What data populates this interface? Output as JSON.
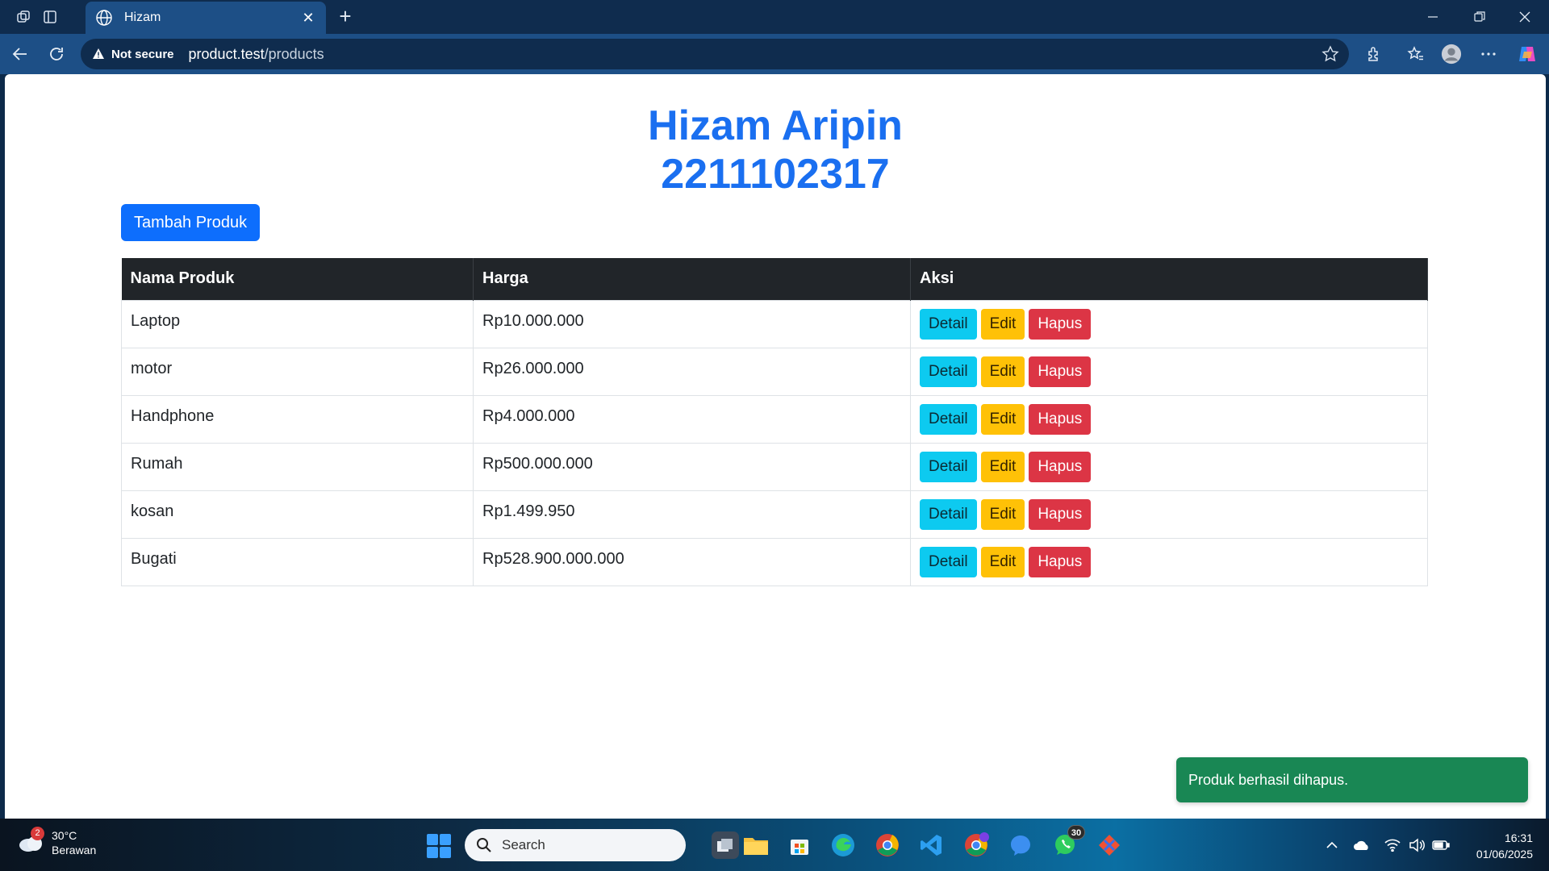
{
  "browser": {
    "tab_title": "Hizam",
    "security_label": "Not secure",
    "url_host": "product.test",
    "url_path": "/products"
  },
  "page": {
    "heading_name": "Hizam Aripin",
    "heading_id": "2211102317",
    "add_button": "Tambah Produk",
    "table": {
      "headers": [
        "Nama Produk",
        "Harga",
        "Aksi"
      ],
      "rows": [
        {
          "name": "Laptop",
          "price": "Rp10.000.000"
        },
        {
          "name": "motor",
          "price": "Rp26.000.000"
        },
        {
          "name": "Handphone",
          "price": "Rp4.000.000"
        },
        {
          "name": "Rumah",
          "price": "Rp500.000.000"
        },
        {
          "name": "kosan",
          "price": "Rp1.499.950"
        },
        {
          "name": "Bugati",
          "price": "Rp528.900.000.000"
        }
      ],
      "action_labels": {
        "detail": "Detail",
        "edit": "Edit",
        "delete": "Hapus"
      }
    },
    "toast": "Produk berhasil dihapus."
  },
  "taskbar": {
    "weather_badge": "2",
    "temperature": "30°C",
    "weather_desc": "Berawan",
    "search_label": "Search",
    "whatsapp_badge": "30",
    "time": "16:31",
    "date": "01/06/2025"
  },
  "colors": {
    "heading": "#1a6ff0",
    "primary": "#0d6efd",
    "info": "#0dcaf0",
    "warning": "#ffc107",
    "danger": "#dc3545",
    "success": "#198754",
    "table_header": "#212529"
  }
}
